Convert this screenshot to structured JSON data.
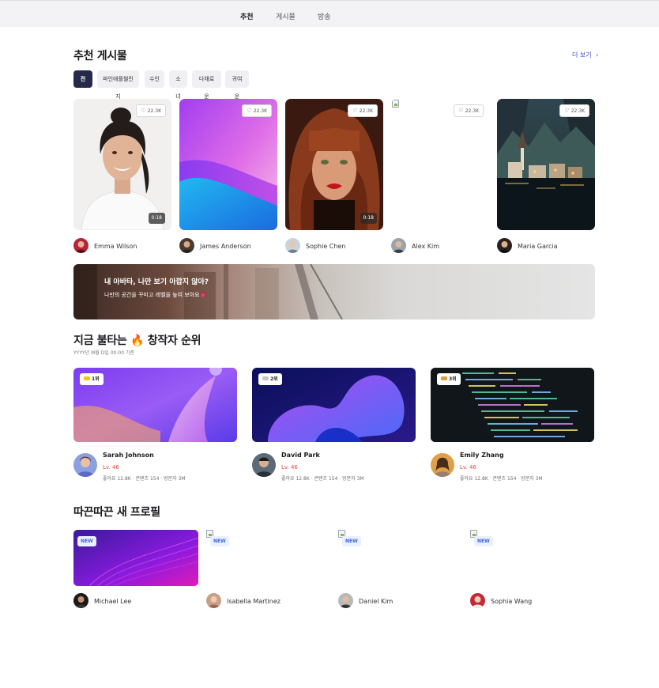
{
  "nav": {
    "tabs": [
      "추천",
      "게시물",
      "방송"
    ]
  },
  "recommended": {
    "title": "추천 게시물",
    "more": "더 보기",
    "chips": [
      "전체",
      "파인애플챌린지",
      "수인",
      "소녀",
      "다채로운",
      "귀여운"
    ],
    "posts": [
      {
        "likes": "22.3K",
        "duration": "0:18",
        "author": "Emma Wilson"
      },
      {
        "likes": "22.3K",
        "author": "James Anderson"
      },
      {
        "likes": "22.3K",
        "duration": "0:18",
        "author": "Sophie Chen"
      },
      {
        "likes": "22.3K",
        "author": "Alex Kim"
      },
      {
        "likes": "22.3K",
        "author": "Maria Garcia"
      }
    ]
  },
  "banner": {
    "title": "내 아바타, 나만 보기 아깝지 않아?",
    "subtitle": "나만의 공간을 꾸미고 레벨을 높여 보아요💗"
  },
  "ranking": {
    "title": "지금 불타는 🔥 창작자 순위",
    "date": "YYYY년 M월 D일 00:00 기준",
    "creators": [
      {
        "rank": "1위",
        "name": "Sarah Johnson",
        "level": "Lv. 46",
        "stats": "좋아요 12.8K · 콘텐츠 154 · 방문자 3M",
        "crown_color": "#f5c518"
      },
      {
        "rank": "2위",
        "name": "David Park",
        "level": "Lv. 46",
        "stats": "좋아요 12.8K · 콘텐츠 154 · 방문자 3M",
        "crown_color": "#c8c8cc"
      },
      {
        "rank": "3위",
        "name": "Emily Zhang",
        "level": "Lv. 46",
        "stats": "좋아요 12.8K · 콘텐츠 154 · 방문자 3M",
        "crown_color": "#d9a23a"
      }
    ]
  },
  "newProfiles": {
    "title": "따끈따끈 새 프로필",
    "badge": "NEW",
    "profiles": [
      {
        "name": "Michael Lee"
      },
      {
        "name": "Isabella Martinez"
      },
      {
        "name": "Daniel Kim"
      },
      {
        "name": "Sophia Wang"
      }
    ]
  },
  "icons": {
    "like": "heart-outline-icon",
    "more": "chevron-right-icon",
    "crown": "crown-icon",
    "fire": "fire-emoji"
  }
}
